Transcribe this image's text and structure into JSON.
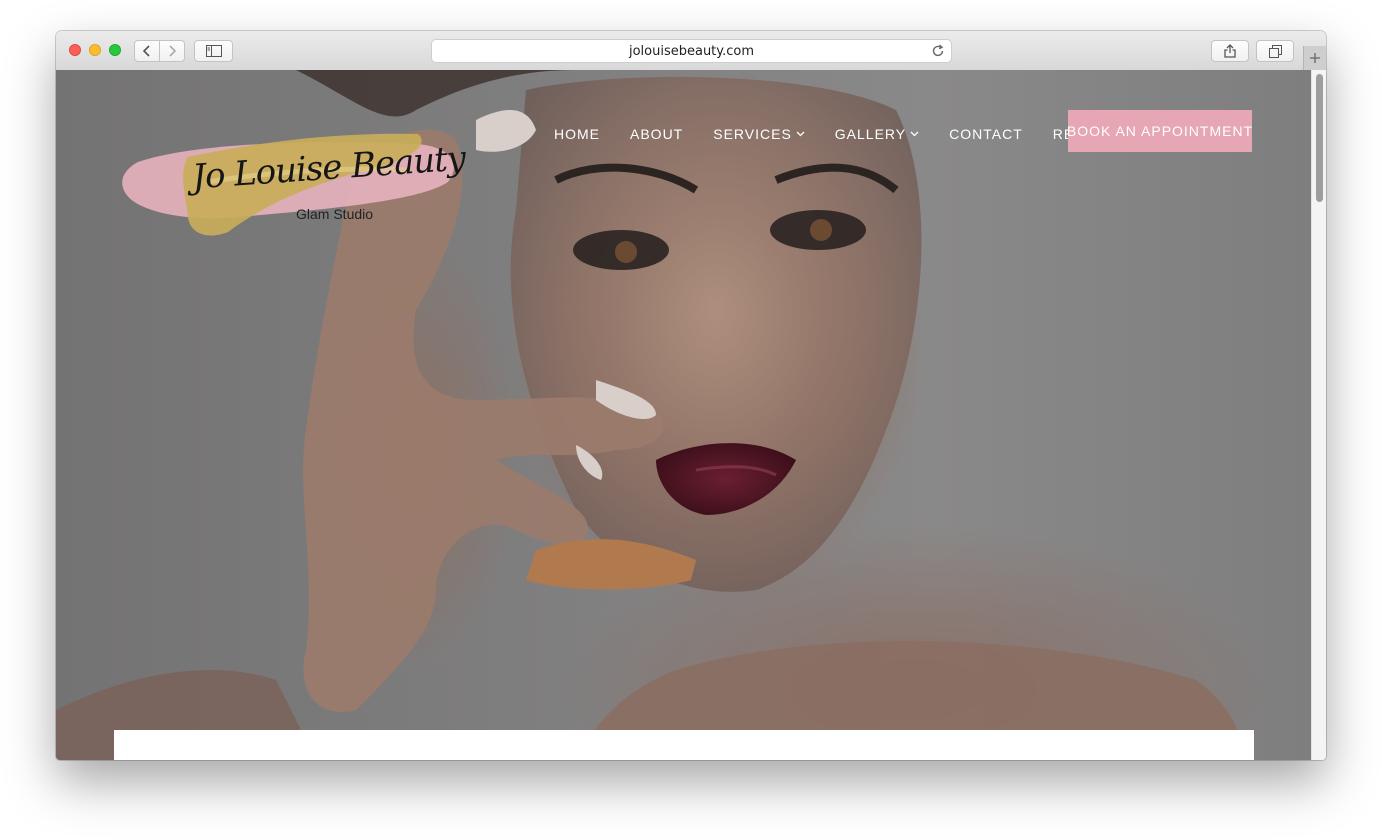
{
  "browser": {
    "url": "jolouisebeauty.com"
  },
  "logo": {
    "name": "Jo Louise Beauty",
    "tagline": "Glam Studio"
  },
  "nav": {
    "items": [
      {
        "label": "HOME"
      },
      {
        "label": "ABOUT"
      },
      {
        "label": "SERVICES"
      },
      {
        "label": "GALLERY"
      },
      {
        "label": "CONTACT"
      },
      {
        "label": "REVIEWS"
      }
    ],
    "cta_label": "BOOK AN APPOINTMENT"
  },
  "colors": {
    "accent": "#e6a6b3",
    "hero_overlay": "#7d7c7d"
  }
}
